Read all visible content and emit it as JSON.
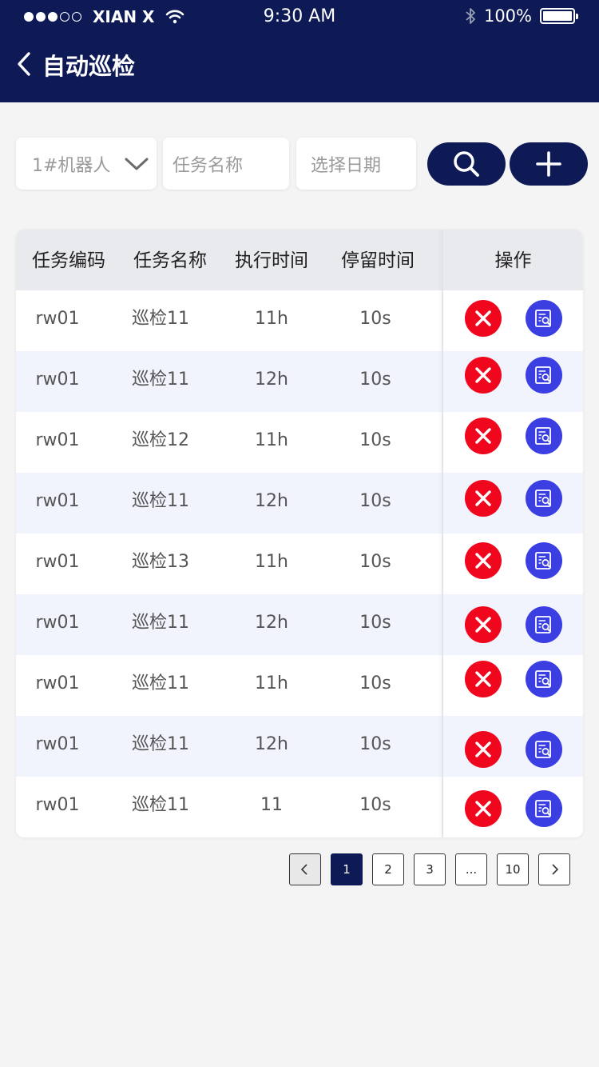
{
  "status_bar": {
    "carrier": "XIAN X",
    "time": "9:30 AM",
    "battery": "100%"
  },
  "nav": {
    "title": "自动巡检",
    "back_icon": "chevron-left-icon"
  },
  "filters": {
    "robot": "1#机器人",
    "task_name_placeholder": "任务名称",
    "date_placeholder": "选择日期",
    "search_icon": "search-icon",
    "add_icon": "plus-icon"
  },
  "table": {
    "headers": [
      "任务编码",
      "任务名称",
      "执行时间",
      "停留时间",
      "操作"
    ],
    "rows": [
      {
        "code": "rw01",
        "name": "巡检11",
        "exec": "11h",
        "stay": "10s"
      },
      {
        "code": "rw01",
        "name": "巡检11",
        "exec": "12h",
        "stay": "10s"
      },
      {
        "code": "rw01",
        "name": "巡检12",
        "exec": "11h",
        "stay": "10s"
      },
      {
        "code": "rw01",
        "name": "巡检11",
        "exec": "12h",
        "stay": "10s"
      },
      {
        "code": "rw01",
        "name": "巡检13",
        "exec": "11h",
        "stay": "10s"
      },
      {
        "code": "rw01",
        "name": "巡检11",
        "exec": "12h",
        "stay": "10s"
      },
      {
        "code": "rw01",
        "name": "巡检11",
        "exec": "11h",
        "stay": "10s"
      },
      {
        "code": "rw01",
        "name": "巡检11",
        "exec": "12h",
        "stay": "10s"
      },
      {
        "code": "rw01",
        "name": "巡检11",
        "exec": "11",
        "stay": "10s"
      }
    ]
  },
  "pagination": {
    "pages": [
      "1",
      "2",
      "3",
      "...",
      "10"
    ],
    "current": "1"
  },
  "colors": {
    "header_bg": "#0e1a56",
    "delete": "#f0071e",
    "view": "#3b3fe2",
    "alt_row": "#f1f3fd"
  }
}
